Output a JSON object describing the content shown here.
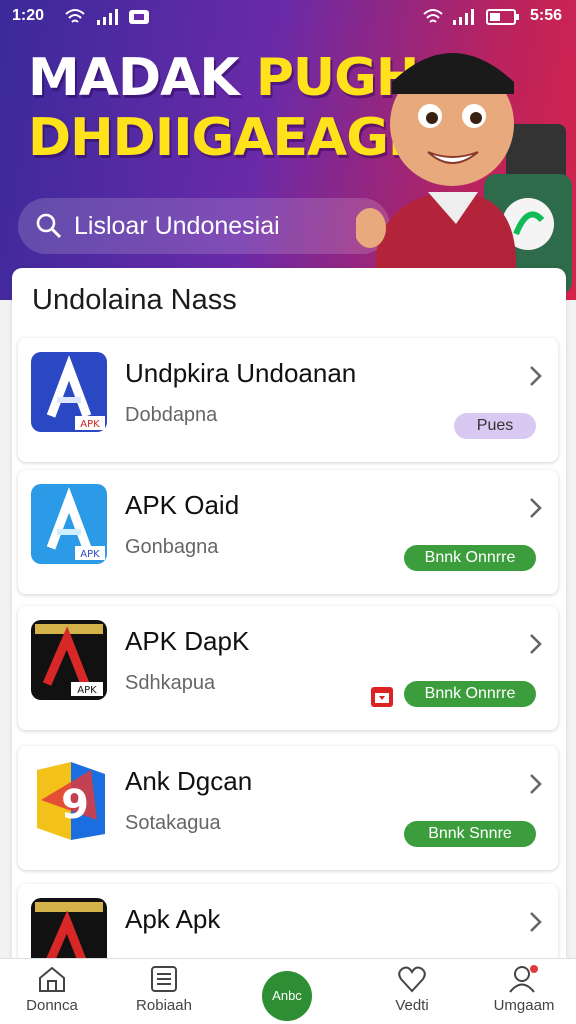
{
  "status_bar": {
    "time_left": "1:20",
    "time_right": "5:56"
  },
  "hero": {
    "title_word1": "MADAK",
    "title_word2": "PUGH",
    "title_line2": "DHDIIGAEAGH",
    "search_placeholder": "Lisloar Undonesiai"
  },
  "list": {
    "title": "Undolaina Nass",
    "items": [
      {
        "name": "Undpkira Undoanan",
        "sub": "Dobdapna",
        "badge": "Pues",
        "badge_style": "purple",
        "icon_label": "APK"
      },
      {
        "name": "APK Oaid",
        "sub": "Gonbagna",
        "badge": "Bnnk Onnrre",
        "badge_style": "green",
        "icon_label": "APK"
      },
      {
        "name": "APK DapK",
        "sub": "Sdhkapua",
        "badge": "Bnnk Onnrre",
        "badge_style": "green",
        "icon_label": "APK"
      },
      {
        "name": "Ank Dgcan",
        "sub": "Sotakagua",
        "badge": "Bnnk Snnre",
        "badge_style": "green",
        "icon_label": "9"
      },
      {
        "name": "Apk Apk",
        "sub": "",
        "badge": "",
        "badge_style": "",
        "icon_label": "A"
      }
    ]
  },
  "bottom_nav": {
    "home": "Donnca",
    "list": "Robiaah",
    "center": "Anbc",
    "fav": "Vedti",
    "profile": "Umgaam"
  }
}
